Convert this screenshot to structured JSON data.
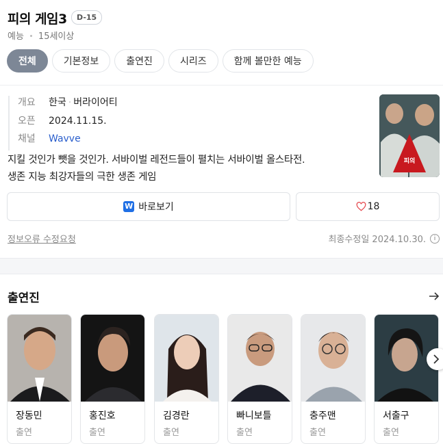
{
  "header": {
    "title": "피의 게임3",
    "dday": "D-15",
    "genre": "예능",
    "rating": "15세이상"
  },
  "tabs": [
    {
      "label": "전체",
      "active": true
    },
    {
      "label": "기본정보"
    },
    {
      "label": "출연진"
    },
    {
      "label": "시리즈"
    },
    {
      "label": "함께 볼만한 예능"
    }
  ],
  "info": {
    "summary_key": "개요",
    "summary_country": "한국",
    "summary_type": "버라이어티",
    "open_key": "오픈",
    "open_value": "2024.11.15.",
    "channel_key": "채널",
    "channel_value": "Wavve"
  },
  "description": {
    "line1": "지킬 것인가 뺏을 것인가. 서바이벌 레전드들이 펼치는 서바이벌 올스타전.",
    "line2": "생존 지능 최강자들의 극한 생존 게임"
  },
  "actions": {
    "watch_label": "바로보기",
    "watch_logo": "W",
    "like_count": "18"
  },
  "footer": {
    "report_label": "정보오류 수정요청",
    "updated_text": "최종수정일 2024.10.30.",
    "info_glyph": "i"
  },
  "cast": {
    "title": "출연진",
    "members": [
      {
        "name": "장동민",
        "role": "출연"
      },
      {
        "name": "홍진호",
        "role": "출연"
      },
      {
        "name": "김경란",
        "role": "출연"
      },
      {
        "name": "빠니보틀",
        "role": "출연"
      },
      {
        "name": "충주맨",
        "role": "출연"
      },
      {
        "name": "서출구",
        "role": "출연"
      }
    ]
  },
  "colors": {
    "accent_tab": "#7d8796",
    "link": "#2a5ecc",
    "wavve": "#1f6fe5",
    "heart": "#e5484d"
  },
  "icons": {
    "cast_more": "arrow-right-icon",
    "next": "chevron-right-icon",
    "like": "heart-icon"
  }
}
